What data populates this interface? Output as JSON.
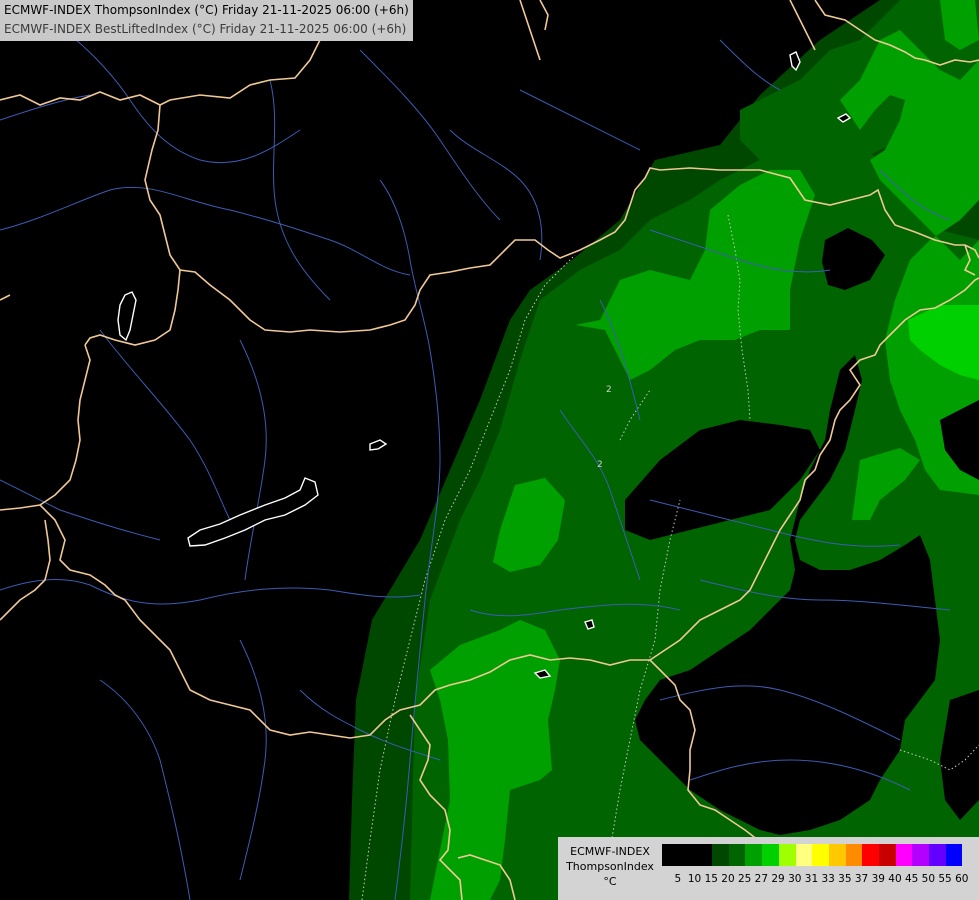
{
  "header": {
    "line1": "ECMWF-INDEX ThompsonIndex (°C) Friday 21-11-2025 06:00 (+6h)",
    "line2": "ECMWF-INDEX BestLiftedIndex (°C) Friday 21-11-2025 06:00 (+6h)"
  },
  "map": {
    "contour_labels": [
      "2",
      "2"
    ],
    "colors": {
      "background": "#000000",
      "border": "#f0c896",
      "river": "#5070c8",
      "lake_outline": "#ffffff",
      "dotted_contour": "#c8c8c8"
    }
  },
  "legend": {
    "title_lines": [
      "ECMWF-INDEX",
      "ThompsonIndex",
      "°C"
    ],
    "levels": [
      "5",
      "10",
      "15",
      "20",
      "25",
      "27",
      "29",
      "30",
      "31",
      "33",
      "35",
      "37",
      "39",
      "40",
      "45",
      "50",
      "55",
      "60"
    ],
    "colors": [
      "#000000",
      "#000000",
      "#000000",
      "#004800",
      "#006400",
      "#00a000",
      "#00d000",
      "#a0ff00",
      "#ffff80",
      "#ffff00",
      "#ffc800",
      "#ff8c00",
      "#ff0000",
      "#c80000",
      "#ff00ff",
      "#b400ff",
      "#6400ff",
      "#0000ff"
    ]
  }
}
